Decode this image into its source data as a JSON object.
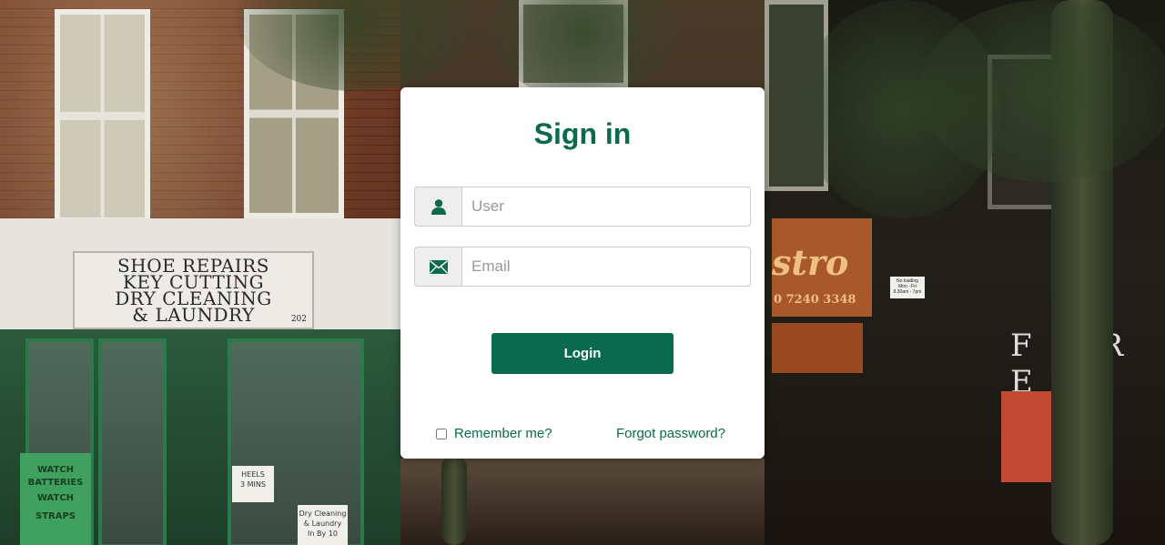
{
  "background": {
    "shop_sign": [
      "SHOE REPAIRS",
      "KEY CUTTING",
      "DRY CLEANING",
      "& LAUNDRY"
    ],
    "shop_number": "202",
    "notice_heels": [
      "HEELS",
      "3 MINS"
    ],
    "notice_dry_cleaning": [
      "Dry Cleaning",
      "& Laundry",
      "In By 10"
    ],
    "green_sign": [
      "WATCH BATTERIES",
      "WATCH STRAPS"
    ],
    "bistro_word": "stro",
    "bistro_phone": "0 7240 3348",
    "street_sign": [
      "No loading",
      "Mon - Fri",
      "8.30am - 7pm"
    ],
    "fire_sign": "F I R E"
  },
  "login": {
    "title": "Sign in",
    "user_placeholder": "User",
    "user_value": "",
    "email_placeholder": "Email",
    "email_value": "",
    "user_icon": "user-icon",
    "email_icon": "envelope-icon",
    "login_label": "Login",
    "remember_label": "Remember me?",
    "remember_checked": false,
    "forgot_label": "Forgot password?"
  },
  "colors": {
    "accent": "#0b6a4e",
    "card_bg": "#ffffff",
    "addon_bg": "#eeeeee",
    "input_border": "#cccccc"
  }
}
